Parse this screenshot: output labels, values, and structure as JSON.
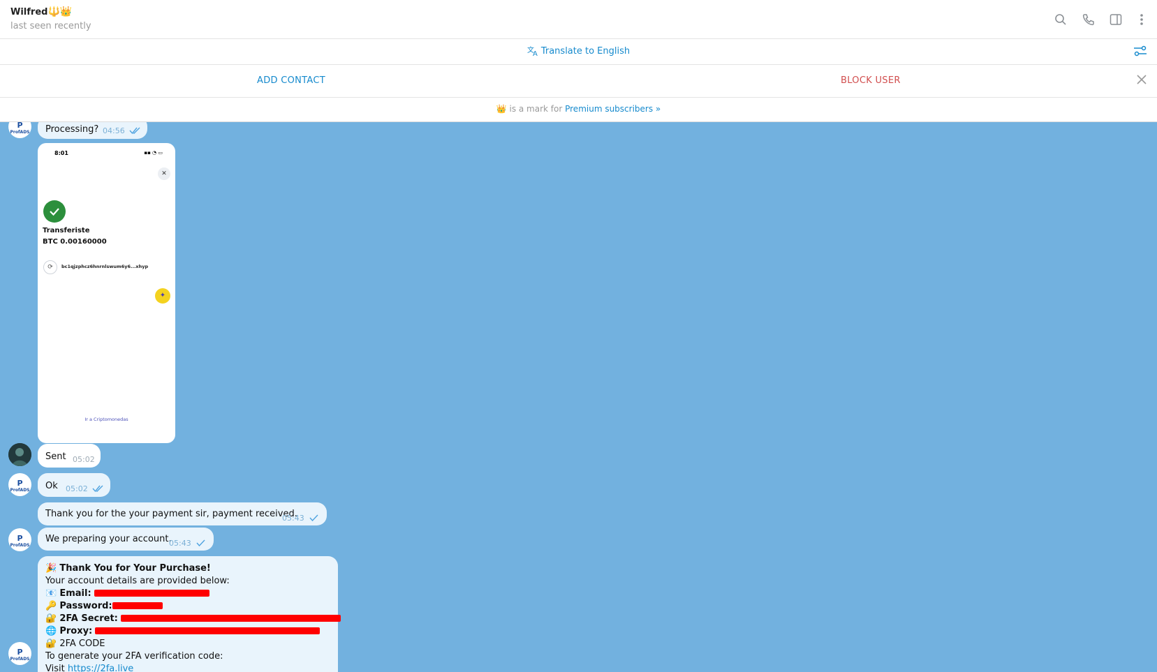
{
  "header": {
    "name": "Wilfred",
    "name_emoji": "🔱👑",
    "status": "last seen recently"
  },
  "translate_bar": {
    "label": "Translate to English"
  },
  "actions": {
    "add_contact": "ADD CONTACT",
    "block_user": "BLOCK USER"
  },
  "premium_bar": {
    "text": " is a mark for ",
    "link": "Premium subscribers »"
  },
  "messages": {
    "m1": {
      "text": "Processing?",
      "time": "04:56"
    },
    "screenshot": {
      "time": "8:01",
      "title": "Transferiste",
      "amount": "BTC 0.00160000",
      "address": "bc1qjzphcz6hnrnlswum6y6...xhyp",
      "link": "Ir a Criptomonedas"
    },
    "m2": {
      "text": "Sent",
      "time": "05:02"
    },
    "m3": {
      "text": "Ok",
      "time": "05:02"
    },
    "m4": {
      "text": "Thank you for the your payment sir, payment received.",
      "time": "05:43"
    },
    "m5": {
      "text": "We preparing your account.",
      "time": "05:43"
    },
    "m6": {
      "line1": "Thank You for Your Purchase!",
      "line2": "Your account details are provided below:",
      "email_label": "Email:",
      "password_label": "Password:",
      "secret_label": "2FA Secret:",
      "proxy_label": "Proxy:",
      "code_label": "2FA CODE",
      "line7": "To generate your 2FA verification code:",
      "visit": "Visit ",
      "visit_link": "https://2fa.live"
    }
  },
  "colors": {
    "chat_bg": "#72b1df",
    "accent": "#168acd",
    "danger": "#d14e4e"
  }
}
